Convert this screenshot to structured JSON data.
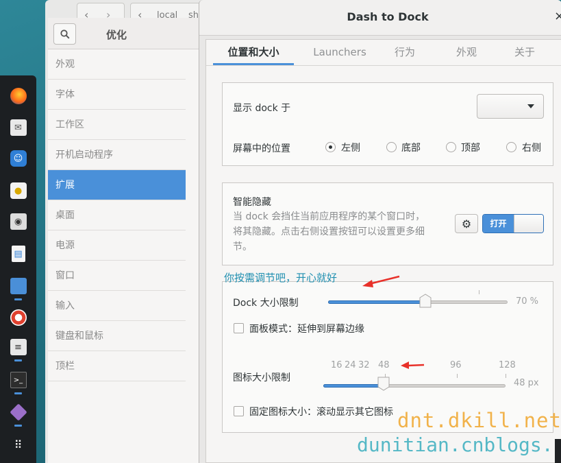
{
  "tweak_tool": {
    "title": "优化",
    "sidebar": [
      {
        "label": "外观"
      },
      {
        "label": "字体"
      },
      {
        "label": "工作区"
      },
      {
        "label": "开机启动程序"
      },
      {
        "label": "扩展",
        "active": true
      },
      {
        "label": "桌面"
      },
      {
        "label": "电源"
      },
      {
        "label": "窗口"
      },
      {
        "label": "输入"
      },
      {
        "label": "键盘和鼠标"
      },
      {
        "label": "顶栏"
      }
    ]
  },
  "background_window": {
    "path_fragment": "local",
    "path_fragment2": "sh"
  },
  "dialog": {
    "title": "Dash to Dock",
    "close_glyph": "×",
    "tabs": [
      {
        "label": "位置和大小",
        "active": true
      },
      {
        "label": "Launchers"
      },
      {
        "label": "行为"
      },
      {
        "label": "外观"
      },
      {
        "label": "关于"
      }
    ],
    "position": {
      "show_on_label": "显示 dock 于",
      "show_on_value": "",
      "screen_position_label": "屏幕中的位置",
      "options": [
        {
          "label": "左侧",
          "checked": true
        },
        {
          "label": "底部",
          "checked": false
        },
        {
          "label": "顶部",
          "checked": false
        },
        {
          "label": "右侧",
          "checked": false
        }
      ]
    },
    "intellihide": {
      "title": "智能隐藏",
      "description": "当 dock 会挡住当前应用程序的某个窗口时，将其隐藏。点击右侧设置按钮可以设置更多细节。",
      "switch_label": "打开",
      "enabled": true
    },
    "dock_size": {
      "label": "Dock 大小限制",
      "value_text": "70 %",
      "value": 0.7,
      "panel_mode_label": "面板模式：延伸到屏幕边缘",
      "panel_mode_checked": false
    },
    "icon_size": {
      "label": "图标大小限制",
      "marks": [
        "16",
        "24",
        "32",
        "48",
        "96",
        "128"
      ],
      "value_text": "48 px",
      "value": 48,
      "fixed_label": "固定图标大小：滚动显示其它图标",
      "fixed_checked": false
    }
  },
  "annotation": {
    "text": "你按需调节吧，开心就好",
    "arrow_color": "#e8312a"
  },
  "watermarks": {
    "line1": "dnt.dkill.net",
    "line2": "dunitian.cnblogs.com"
  },
  "dock_apps": [
    {
      "icon": "firefox-icon",
      "running": false
    },
    {
      "icon": "mail-icon",
      "running": false
    },
    {
      "icon": "chat-icon",
      "running": false
    },
    {
      "icon": "music-icon",
      "running": false
    },
    {
      "icon": "camera-icon",
      "running": false
    },
    {
      "icon": "document-icon",
      "running": false
    },
    {
      "icon": "folder-icon",
      "running": true
    },
    {
      "icon": "help-icon",
      "running": false
    },
    {
      "icon": "tweak-icon",
      "running": true
    },
    {
      "icon": "terminal-icon",
      "running": true
    },
    {
      "icon": "gem-icon",
      "running": true
    },
    {
      "icon": "app-grid-icon",
      "running": false
    }
  ],
  "colors": {
    "accent": "#4a90d9",
    "annotation_text": "#1f8fb0",
    "watermark1": "#f1b24a",
    "watermark2": "#55b8c6"
  }
}
